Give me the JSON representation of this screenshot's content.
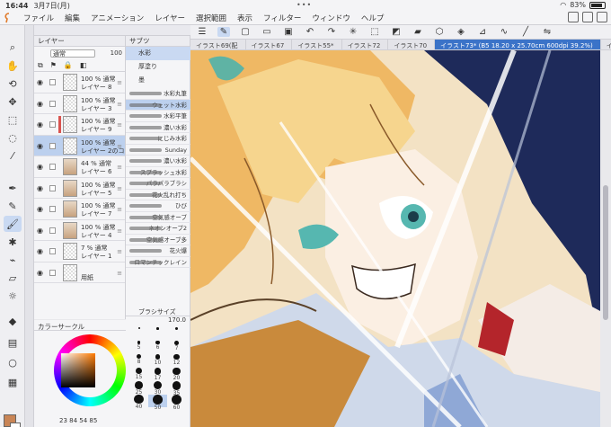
{
  "status_bar": {
    "time": "16:44",
    "date": "3月7日(月)",
    "battery": "83%"
  },
  "menu": [
    "ファイル",
    "編集",
    "アニメーション",
    "レイヤー",
    "選択範囲",
    "表示",
    "フィルター",
    "ウィンドウ",
    "ヘルプ"
  ],
  "layer_panel": {
    "tabs": [
      "レイヤー"
    ],
    "blend_mode": "通常",
    "opacity": "100",
    "layers": [
      {
        "mode": "100 % 通常",
        "name": "レイヤー 8",
        "thumb": "empty",
        "clip": false,
        "selected": false
      },
      {
        "mode": "100 % 通常",
        "name": "レイヤー 3",
        "thumb": "empty",
        "clip": false,
        "selected": false
      },
      {
        "mode": "100 % 通常",
        "name": "レイヤー 9",
        "thumb": "empty",
        "clip": true,
        "selected": false
      },
      {
        "mode": "100 % 通常",
        "name": "レイヤー 2のコ",
        "thumb": "empty",
        "clip": false,
        "selected": true
      },
      {
        "mode": "44 % 通常",
        "name": "レイヤー 6",
        "thumb": "pic",
        "clip": false,
        "selected": false
      },
      {
        "mode": "100 % 通常",
        "name": "レイヤー 5",
        "thumb": "pic",
        "clip": false,
        "selected": false
      },
      {
        "mode": "100 % 通常",
        "name": "レイヤー 7",
        "thumb": "pic",
        "clip": false,
        "selected": false
      },
      {
        "mode": "100 % 通常",
        "name": "レイヤー 4",
        "thumb": "pic",
        "clip": false,
        "selected": false
      },
      {
        "mode": "7 % 通常",
        "name": "レイヤー 1",
        "thumb": "empty",
        "clip": false,
        "selected": false
      },
      {
        "mode": "",
        "name": "用紙",
        "thumb": "empty",
        "clip": false,
        "selected": false
      }
    ]
  },
  "color_panel": {
    "title": "カラーサークル",
    "values": "23  84  54  85",
    "main_color": "#c98556"
  },
  "subtool_panel": {
    "tab": "サブツ",
    "categories": [
      "水彩",
      "厚塗り",
      "墨"
    ],
    "brushes": [
      "水彩丸筆",
      "ウェット水彩",
      "水彩平筆",
      "濃い水彩",
      "にじみ水彩",
      "Sunday",
      "濃い水彩",
      "スプラッシュ水彩",
      "パラパラブラシ",
      "花火乱れ打ち",
      "ひび",
      "空気感オーブ",
      "ネオンオーブ2",
      "空気感オーブ多",
      "花火爆",
      "ロマンチックレイン"
    ]
  },
  "brush_size": {
    "title": "ブラシサイズ",
    "value": "170.0",
    "sizes": [
      "",
      "",
      "",
      "5",
      "6",
      "7",
      "8",
      "10",
      "12",
      "15",
      "17",
      "20",
      "25",
      "30",
      "35",
      "40",
      "50",
      "60"
    ]
  },
  "canvas_tabs": [
    "イラスト69(配",
    "イラスト67",
    "イラスト55*",
    "イラスト72",
    "イラスト70",
    "イラスト73* (B5 18.20 x 25.70cm 600dpi 39.2%)",
    "イラ"
  ],
  "active_tab_index": 5
}
